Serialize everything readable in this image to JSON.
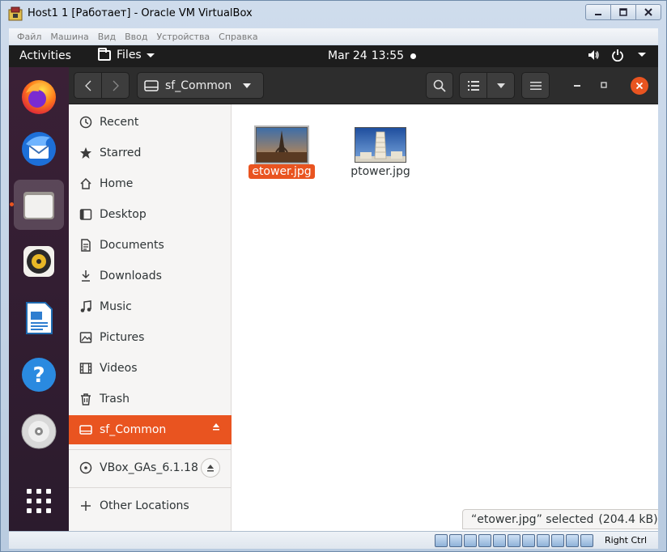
{
  "host": {
    "title": "Host1 1 [Работает] - Oracle VM VirtualBox",
    "menu": [
      "Файл",
      "Машина",
      "Вид",
      "Ввод",
      "Устройства",
      "Справка"
    ],
    "host_key": "Right Ctrl"
  },
  "topbar": {
    "activities": "Activities",
    "app_menu": "Files",
    "date": "Mar 24",
    "time": "13:55"
  },
  "dock": {
    "items": [
      "firefox-icon",
      "thunderbird-icon",
      "files-icon",
      "rhythmbox-icon",
      "writer-icon",
      "help-icon",
      "dvd-icon",
      "show-apps-icon"
    ]
  },
  "headerbar": {
    "path_label": "sf_Common"
  },
  "sidebar": {
    "items": [
      {
        "label": "Recent",
        "icon": "clock-icon"
      },
      {
        "label": "Starred",
        "icon": "star-icon"
      },
      {
        "label": "Home",
        "icon": "home-icon"
      },
      {
        "label": "Desktop",
        "icon": "desktop-icon"
      },
      {
        "label": "Documents",
        "icon": "document-icon"
      },
      {
        "label": "Downloads",
        "icon": "download-icon"
      },
      {
        "label": "Music",
        "icon": "music-icon"
      },
      {
        "label": "Pictures",
        "icon": "picture-icon"
      },
      {
        "label": "Videos",
        "icon": "video-icon"
      },
      {
        "label": "Trash",
        "icon": "trash-icon"
      },
      {
        "label": "sf_Common",
        "icon": "drive-icon"
      }
    ],
    "devices": [
      {
        "label": "VBox_GAs_6.1.18",
        "icon": "disc-icon"
      }
    ],
    "other": {
      "label": "Other Locations",
      "icon": "plus-icon"
    }
  },
  "files": [
    {
      "name": "etower.jpg",
      "selected": true
    },
    {
      "name": "ptower.jpg",
      "selected": false
    }
  ],
  "status": {
    "selected_text": "“etower.jpg” selected",
    "size": "(204.4 kB)"
  },
  "colors": {
    "accent": "#e95420",
    "topbar": "#1d1d1d",
    "headerbar": "#2d2d2d",
    "dock": "#2f1c2f"
  }
}
